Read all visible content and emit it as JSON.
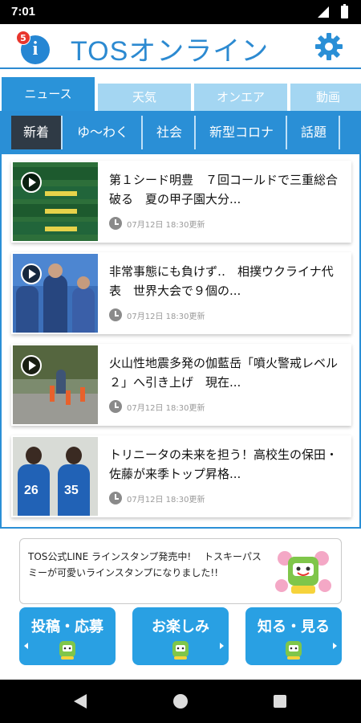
{
  "status": {
    "time": "7:01"
  },
  "app": {
    "title": "TOSオンライン",
    "notification_count": "5",
    "accent": "#2a8fd6"
  },
  "main_tabs": [
    {
      "label": "ニュース",
      "active": true
    },
    {
      "label": "天気",
      "active": false
    },
    {
      "label": "オンエア",
      "active": false
    },
    {
      "label": "動画",
      "active": false
    }
  ],
  "sub_tabs": [
    {
      "label": "新着",
      "active": true
    },
    {
      "label": "ゆ〜わく",
      "active": false
    },
    {
      "label": "社会",
      "active": false
    },
    {
      "label": "新型コロナ",
      "active": false
    },
    {
      "label": "話題",
      "active": false
    }
  ],
  "news": [
    {
      "title": "第１シード明豊　７回コールドで三重総合破る　夏の甲子園大分...",
      "time": "07月12日 18:30更新",
      "video": true
    },
    {
      "title": "非常事態にも負けず‥　相撲ウクライナ代表　世界大会で９個の...",
      "time": "07月12日 18:30更新",
      "video": true
    },
    {
      "title": "火山性地震多発の伽藍岳「噴火警戒レベル２」へ引き上げ　現在...",
      "time": "07月12日 18:30更新",
      "video": true
    },
    {
      "title": "トリニータの未来を担う！高校生の保田・佐藤が来季トップ昇格...",
      "time": "07月12日 18:30更新",
      "video": false
    }
  ],
  "promo": {
    "text": "TOS公式LINE ラインスタンプ発売中!　 トスキーパスミーが可愛いラインスタンプになりました!!"
  },
  "bottom_buttons": [
    {
      "label": "投稿・応募"
    },
    {
      "label": "お楽しみ"
    },
    {
      "label": "知る・見る"
    }
  ],
  "icons": {
    "settings": "gear-icon",
    "play": "play-icon",
    "clock": "clock-icon",
    "nav_back": "back-icon",
    "nav_home": "home-icon",
    "nav_recent": "recent-apps-icon"
  }
}
